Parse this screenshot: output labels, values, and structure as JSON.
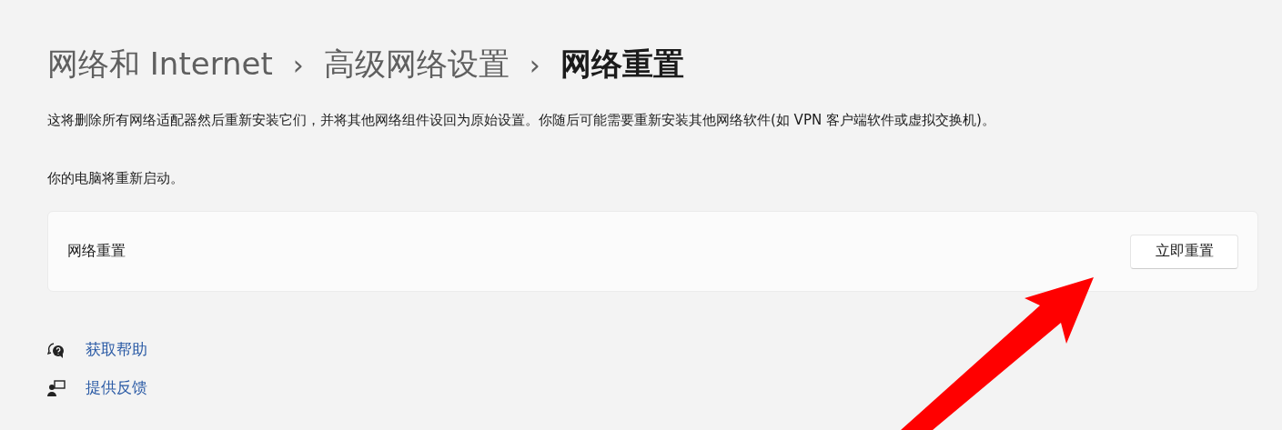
{
  "breadcrumb": [
    {
      "label": "网络和 Internet",
      "separator": "›",
      "selected": false
    },
    {
      "label": "高级网络设置",
      "separator": "›",
      "selected": false
    },
    {
      "label": "网络重置",
      "selected": true
    }
  ],
  "description": "这将删除所有网络适配器然后重新安装它们，并将其他网络组件设回为原始设置。你随后可能需要重新安装其他网络软件(如 VPN 客户端软件或虚拟交换机)。",
  "restart_note": "你的电脑将重新启动。",
  "reset_card": {
    "label": "网络重置",
    "button": "立即重置"
  },
  "links": [
    {
      "kind": "help",
      "label": "获取帮助"
    },
    {
      "kind": "feedback",
      "label": "提供反馈"
    }
  ],
  "annotation": {
    "kind": "arrow"
  }
}
